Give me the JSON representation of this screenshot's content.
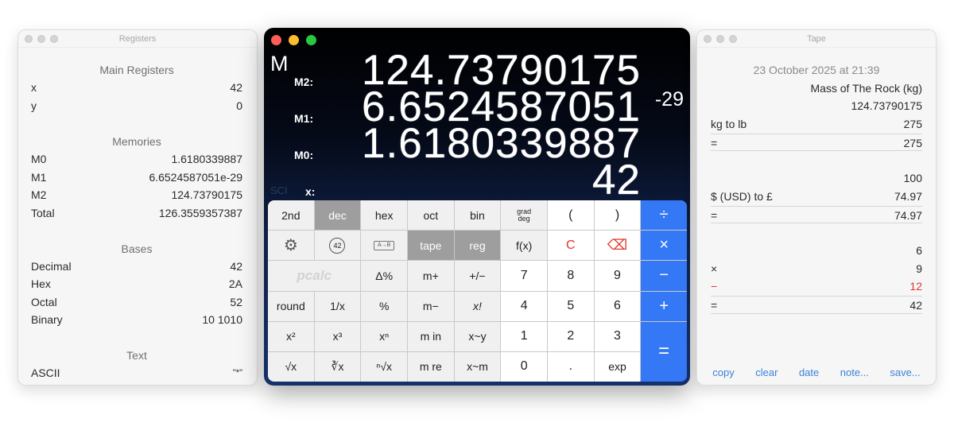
{
  "registers": {
    "title": "Registers",
    "main_head": "Main Registers",
    "main": [
      {
        "label": "x",
        "value": "42"
      },
      {
        "label": "y",
        "value": "0"
      }
    ],
    "memories_head": "Memories",
    "memories": [
      {
        "label": "M0",
        "value": "1.6180339887"
      },
      {
        "label": "M1",
        "value": "6.6524587051e-29"
      },
      {
        "label": "M2",
        "value": "124.73790175"
      },
      {
        "label": "Total",
        "value": "126.3559357387"
      }
    ],
    "bases_head": "Bases",
    "bases": [
      {
        "label": "Decimal",
        "value": "42"
      },
      {
        "label": "Hex",
        "value": "2A"
      },
      {
        "label": "Octal",
        "value": "52"
      },
      {
        "label": "Binary",
        "value": "10 1010"
      }
    ],
    "text_head": "Text",
    "text": [
      {
        "label": "ASCII",
        "value": "\"*\""
      }
    ]
  },
  "calculator": {
    "memory_indicator": "M",
    "labels": {
      "m2": "M2:",
      "m1": "M1:",
      "m0": "M0:",
      "x": "x:"
    },
    "values": {
      "m2": "124.73790175",
      "m1": "6.6524587051",
      "m1_exp": "-29",
      "m0": "1.6180339887",
      "x": "42"
    },
    "mode": "SCI",
    "keys": {
      "second": "2nd",
      "dec": "dec",
      "hex": "hex",
      "oct": "oct",
      "bin": "bin",
      "grad": "grad",
      "deg": "deg",
      "open_paren": "(",
      "close_paren": ")",
      "divide": "÷",
      "gear": "⚙",
      "const": "42",
      "ab": "A→B",
      "tape": "tape",
      "reg": "reg",
      "fx": "f(x)",
      "clear": "C",
      "backspace": "⌫",
      "multiply": "×",
      "logo": "pcalc",
      "delta_pct": "Δ%",
      "m_plus": "m+",
      "plus_minus": "+/−",
      "seven": "7",
      "eight": "8",
      "nine": "9",
      "minus": "−",
      "round": "round",
      "reciprocal": "1/x",
      "percent": "%",
      "m_minus": "m−",
      "factorial": "x!",
      "four": "4",
      "five": "5",
      "six": "6",
      "plus": "+",
      "x_squared": "x²",
      "x_cubed": "x³",
      "x_n": "xⁿ",
      "m_in": "m in",
      "x_swap_y": "x~y",
      "one": "1",
      "two": "2",
      "three": "3",
      "equals": "=",
      "sqrt": "√x",
      "cbrt": "∛x",
      "nrt": "ⁿ√x",
      "m_re": "m re",
      "x_swap_m": "x~m",
      "zero": "0",
      "point": ".",
      "exp": "exp"
    }
  },
  "tape": {
    "title": "Tape",
    "date": "23 October 2025 at 21:39",
    "note": "Mass of The Rock (kg)",
    "lines": [
      {
        "op": "",
        "value": "124.73790175"
      },
      {
        "op": "kg to lb",
        "value": "275"
      },
      {
        "op": "=",
        "value": "275"
      },
      {
        "op": "",
        "value": ""
      },
      {
        "op": "",
        "value": "100"
      },
      {
        "op": "$ (USD) to £",
        "value": "74.97"
      },
      {
        "op": "=",
        "value": "74.97"
      },
      {
        "op": "",
        "value": ""
      },
      {
        "op": "",
        "value": "6"
      },
      {
        "op": "×",
        "value": "9"
      },
      {
        "op": "−",
        "value": "12"
      },
      {
        "op": "=",
        "value": "42"
      }
    ],
    "actions": {
      "copy": "copy",
      "clear": "clear",
      "date": "date",
      "note": "note...",
      "save": "save..."
    }
  },
  "colors": {
    "accent": "#3478f6",
    "selected_key": "#9e9e9e",
    "negative": "#e0352c",
    "link": "#3a82d8"
  }
}
